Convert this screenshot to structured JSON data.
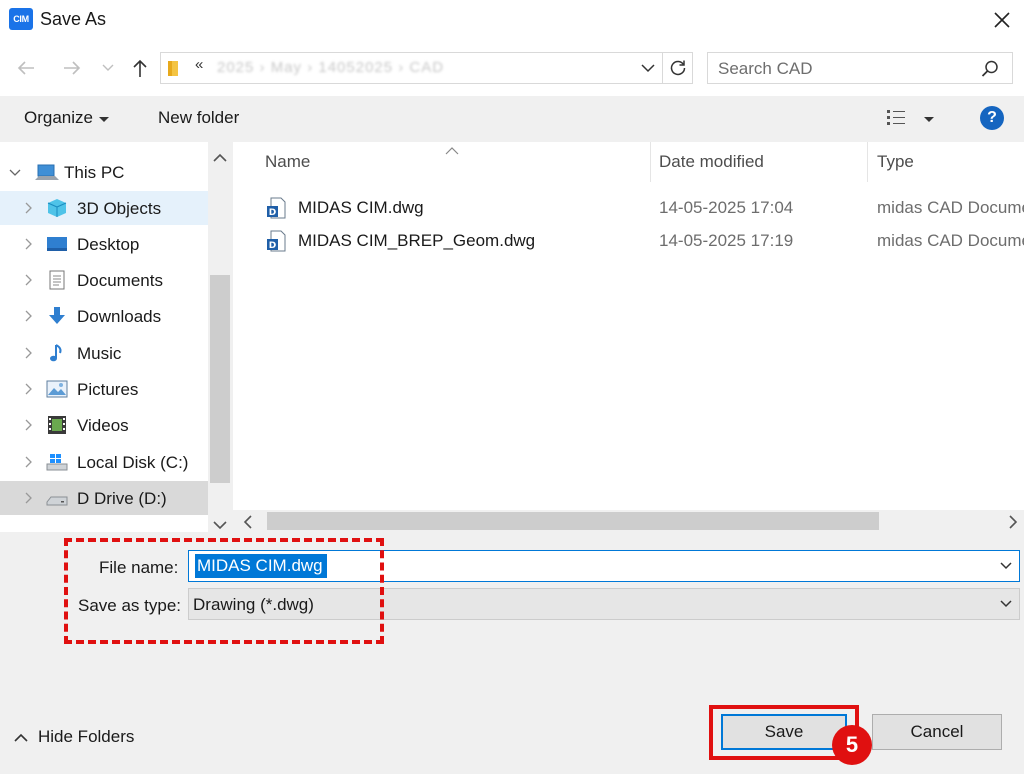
{
  "window": {
    "title": "Save As",
    "app_icon_text": "CIM"
  },
  "address": {
    "chevron": "«",
    "path": "2025 › May › 14052025 › CAD"
  },
  "search": {
    "placeholder": "Search CAD"
  },
  "toolbar": {
    "organize_label": "Organize",
    "new_folder_label": "New folder",
    "help_label": "?"
  },
  "nav": {
    "root_label": "This PC",
    "items": [
      {
        "label": "3D Objects",
        "icon": "cube-icon"
      },
      {
        "label": "Desktop",
        "icon": "desktop-icon"
      },
      {
        "label": "Documents",
        "icon": "document-icon"
      },
      {
        "label": "Downloads",
        "icon": "download-icon"
      },
      {
        "label": "Music",
        "icon": "music-icon"
      },
      {
        "label": "Pictures",
        "icon": "picture-icon"
      },
      {
        "label": "Videos",
        "icon": "video-icon"
      },
      {
        "label": "Local Disk (C:)",
        "icon": "disk-icon"
      },
      {
        "label": "D Drive (D:)",
        "icon": "drive-icon"
      }
    ]
  },
  "columns": {
    "name": "Name",
    "date": "Date modified",
    "type": "Type"
  },
  "files": [
    {
      "name": "MIDAS CIM.dwg",
      "date": "14-05-2025 17:04",
      "type": "midas CAD Document"
    },
    {
      "name": "MIDAS CIM_BREP_Geom.dwg",
      "date": "14-05-2025 17:19",
      "type": "midas CAD Document"
    }
  ],
  "form": {
    "file_name_label": "File name:",
    "file_name_value": "MIDAS CIM.dwg",
    "save_type_label": "Save as type:",
    "save_type_value": "Drawing (*.dwg)"
  },
  "footer": {
    "hide_folders_label": "Hide Folders",
    "save_label": "Save",
    "cancel_label": "Cancel",
    "step_number": "5"
  },
  "colors": {
    "accent": "#0078d7",
    "annotation": "#e01010",
    "selection": "#e5f1fb"
  }
}
